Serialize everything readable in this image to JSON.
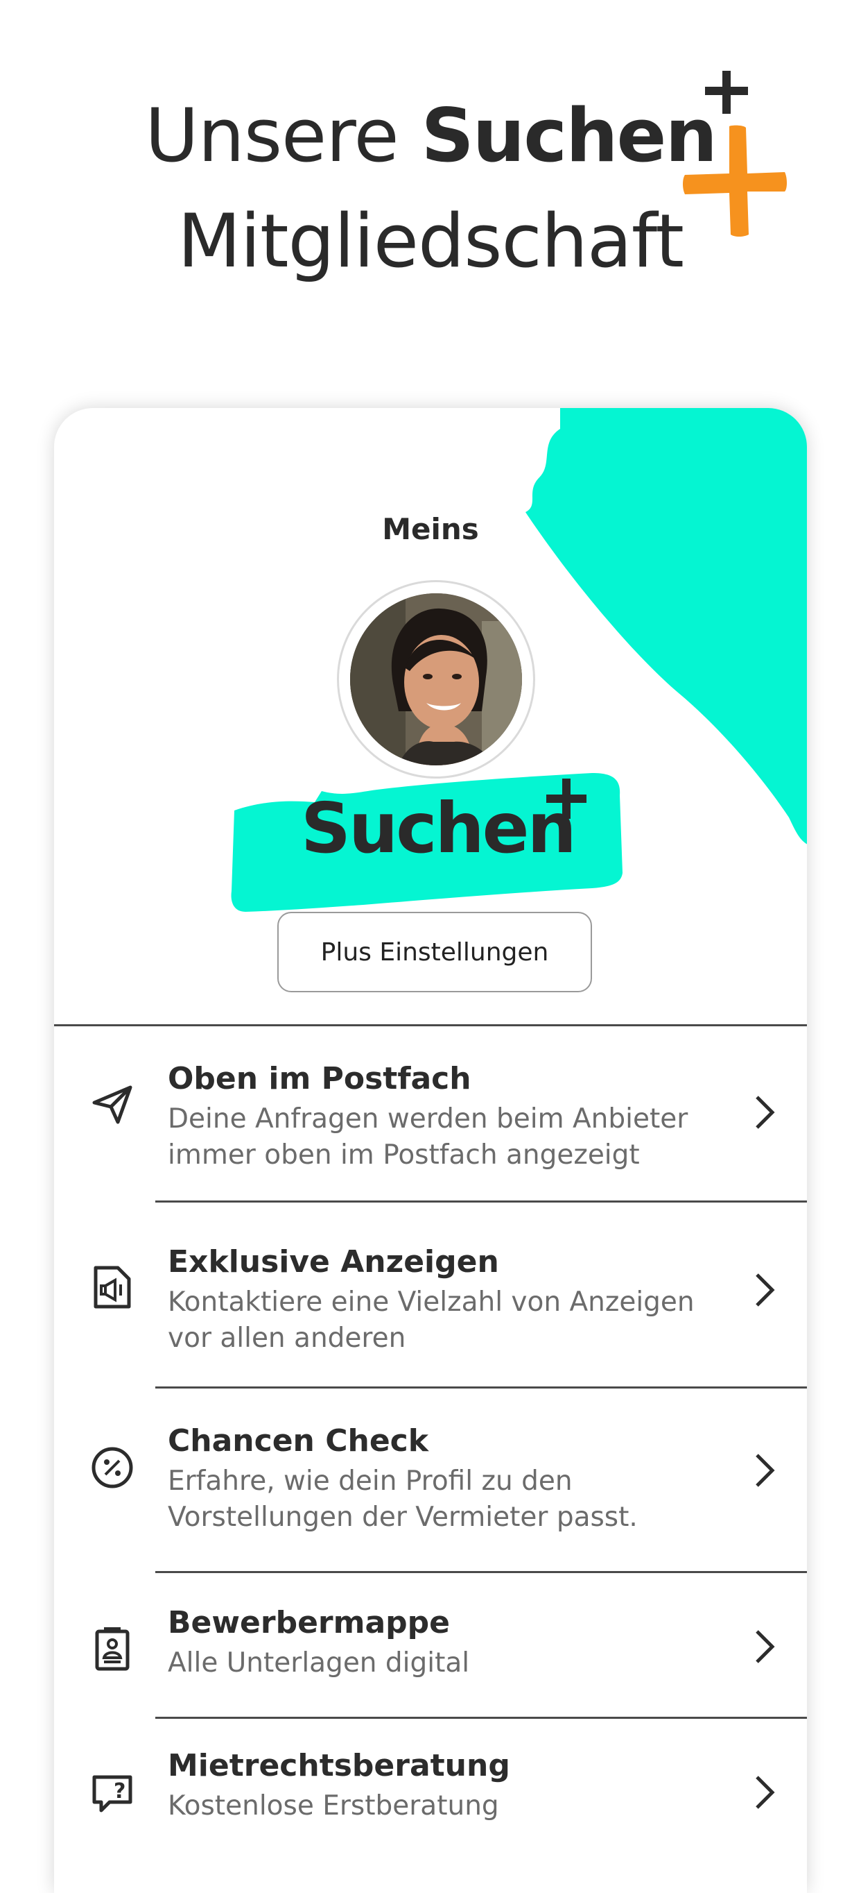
{
  "header": {
    "line1_prefix": "Unsere",
    "brand_name": "Suchen",
    "line2": "Mitgliedschaft",
    "accent_orange": "#F6921E"
  },
  "card": {
    "title": "Meins",
    "brand_name": "Suchen",
    "brand_color": "#05F5D2",
    "settings_button_label": "Plus Einstellungen",
    "avatar": "profile-photo-woman-smiling"
  },
  "features": [
    {
      "icon": "send-icon",
      "title": "Oben im Postfach",
      "desc": "Deine Anfragen werden beim Anbieter immer oben im Postfach angezeigt"
    },
    {
      "icon": "exclusive-listing-icon",
      "title": "Exklusive Anzeigen",
      "desc": "Kontaktiere eine Vielzahl von Anzeigen vor allen anderen"
    },
    {
      "icon": "percent-icon",
      "title": "Chancen Check",
      "desc": "Erfahre, wie dein Profil zu den Vorstellungen der Vermieter passt."
    },
    {
      "icon": "clipboard-id-icon",
      "title": "Bewerbermappe",
      "desc": "Alle Unterlagen digital"
    },
    {
      "icon": "chat-question-icon",
      "title": "Mietrechtsberatung",
      "desc": "Kostenlose Erstberatung"
    }
  ]
}
